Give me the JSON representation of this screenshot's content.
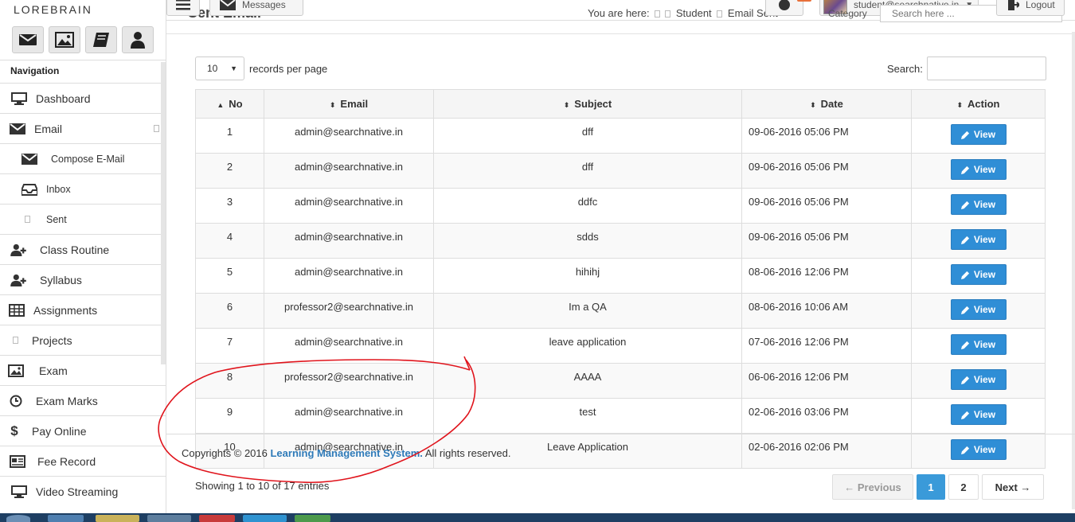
{
  "brand": {
    "name": "LOREBRAIN"
  },
  "quick_buttons": [
    {
      "icon": "envelope-icon"
    },
    {
      "icon": "image-icon"
    },
    {
      "icon": "book-icon"
    },
    {
      "icon": "user-icon"
    }
  ],
  "navigation": {
    "title": "Navigation",
    "items": [
      {
        "label": "Dashboard",
        "icon": "monitor-icon"
      },
      {
        "label": "Email",
        "icon": "envelope-icon"
      },
      {
        "label": "Compose E-Mail",
        "icon": "envelope-icon"
      },
      {
        "label": "Inbox",
        "icon": "inbox-icon"
      },
      {
        "label": "Sent",
        "icon": "box-icon"
      },
      {
        "label": "Class Routine",
        "icon": "user-plus-icon"
      },
      {
        "label": "Syllabus",
        "icon": "user-plus-icon"
      },
      {
        "label": "Assignments",
        "icon": "table-icon"
      },
      {
        "label": "Projects",
        "icon": "box-icon"
      },
      {
        "label": "Exam",
        "icon": "image-icon"
      },
      {
        "label": "Exam Marks",
        "icon": "clock-icon"
      },
      {
        "label": "Pay Online",
        "icon": "dollar-icon"
      },
      {
        "label": "Fee Record",
        "icon": "newspaper-icon"
      },
      {
        "label": "Video Streaming",
        "icon": "monitor-icon"
      }
    ]
  },
  "header": {
    "messages_label": "Messages",
    "page_title": "Sent Email",
    "breadcrumb": {
      "prefix": "You are here:",
      "items": [
        "Student",
        "Email Sent"
      ]
    },
    "user_email": "student@searchnative.in",
    "category_label": "Category",
    "search_placeholder": "Search here ...",
    "logout_label": "Logout"
  },
  "table_controls": {
    "page_length": "10",
    "records_label": "records per page",
    "search_label": "Search:"
  },
  "table": {
    "columns": [
      "No",
      "Email",
      "Subject",
      "Date",
      "Action"
    ],
    "view_label": "View",
    "rows": [
      {
        "no": "1",
        "email": "admin@searchnative.in",
        "subject": "dff",
        "date": "09-06-2016 05:06 PM"
      },
      {
        "no": "2",
        "email": "admin@searchnative.in",
        "subject": "dff",
        "date": "09-06-2016 05:06 PM"
      },
      {
        "no": "3",
        "email": "admin@searchnative.in",
        "subject": "ddfc",
        "date": "09-06-2016 05:06 PM"
      },
      {
        "no": "4",
        "email": "admin@searchnative.in",
        "subject": "sdds",
        "date": "09-06-2016 05:06 PM"
      },
      {
        "no": "5",
        "email": "admin@searchnative.in",
        "subject": "hihihj",
        "date": "08-06-2016 12:06 PM"
      },
      {
        "no": "6",
        "email": "professor2@searchnative.in",
        "subject": "Im a QA",
        "date": "08-06-2016 10:06 AM"
      },
      {
        "no": "7",
        "email": "admin@searchnative.in",
        "subject": "leave application",
        "date": "07-06-2016 12:06 PM"
      },
      {
        "no": "8",
        "email": "professor2@searchnative.in",
        "subject": "AAAA",
        "date": "06-06-2016 12:06 PM"
      },
      {
        "no": "9",
        "email": "admin@searchnative.in",
        "subject": "test",
        "date": "02-06-2016 03:06 PM"
      },
      {
        "no": "10",
        "email": "admin@searchnative.in",
        "subject": "Leave Application",
        "date": "02-06-2016 02:06 PM"
      }
    ]
  },
  "footer": {
    "copyright_prefix": "Copyrights © 2016",
    "copyright_link": "Learning Management System.",
    "copyright_suffix": "All rights reserved."
  },
  "pagination": {
    "info": "Showing 1 to 10 of 17 entries",
    "previous": "← Previous",
    "pages": [
      "1",
      "2"
    ],
    "next": "Next →",
    "current_page": "1"
  },
  "colors": {
    "accent": "#2f8ed6",
    "annotation": "#e0141c",
    "taskbar": "#1e3f63"
  }
}
